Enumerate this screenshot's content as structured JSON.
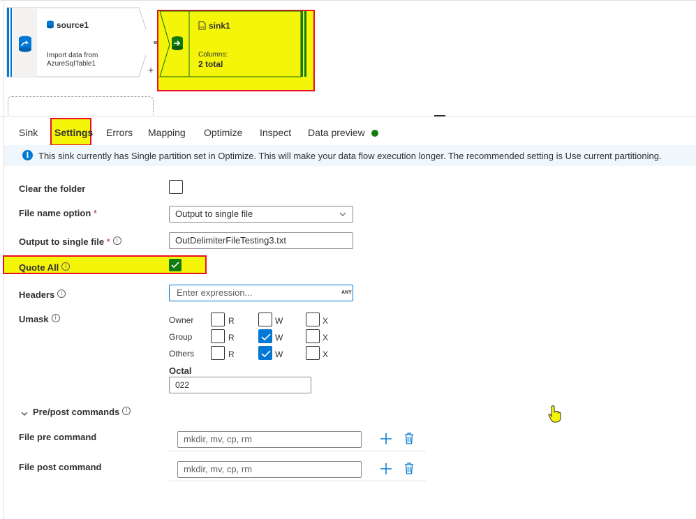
{
  "canvas": {
    "source": {
      "name": "source1",
      "desc_line1": "Import data from",
      "desc_line2": "AzureSqlTable1",
      "plus": "+"
    },
    "sink": {
      "name": "sink1",
      "columns_label": "Columns:",
      "columns_value": "2 total"
    }
  },
  "tabs": [
    "Sink",
    "Settings",
    "Errors",
    "Mapping",
    "Optimize",
    "Inspect",
    "Data preview"
  ],
  "info_bar": {
    "text": "This sink currently has Single partition set in Optimize. This will make your data flow execution longer. The recommended setting is Use current partitioning."
  },
  "form": {
    "clear_folder": {
      "label": "Clear the folder",
      "checked": false
    },
    "file_name_option": {
      "label": "File name option",
      "required": "*",
      "value": "Output to single file"
    },
    "output_single_file": {
      "label": "Output to single file",
      "required": "*",
      "value": "OutDelimiterFileTesting3.txt"
    },
    "quote_all": {
      "label": "Quote All",
      "checked": true
    },
    "headers": {
      "label": "Headers",
      "placeholder": "Enter expression...",
      "badge": "ANY"
    },
    "umask": {
      "label": "Umask",
      "rows": [
        {
          "name": "Owner",
          "r": false,
          "w": false,
          "x": false
        },
        {
          "name": "Group",
          "r": false,
          "w": true,
          "x": false
        },
        {
          "name": "Others",
          "r": false,
          "w": true,
          "x": false
        }
      ],
      "col_r": "R",
      "col_w": "W",
      "col_x": "X",
      "octal_label": "Octal",
      "octal_value": "022"
    },
    "prepost": {
      "label": "Pre/post commands"
    },
    "file_pre": {
      "label": "File pre command",
      "placeholder": "mkdir, mv, cp, rm"
    },
    "file_post": {
      "label": "File post command",
      "placeholder": "mkdir, mv, cp, rm"
    }
  },
  "colors": {
    "accent": "#0078d4",
    "highlight": "#f5f50a",
    "annotation": "#e81123",
    "success": "#107c10"
  }
}
